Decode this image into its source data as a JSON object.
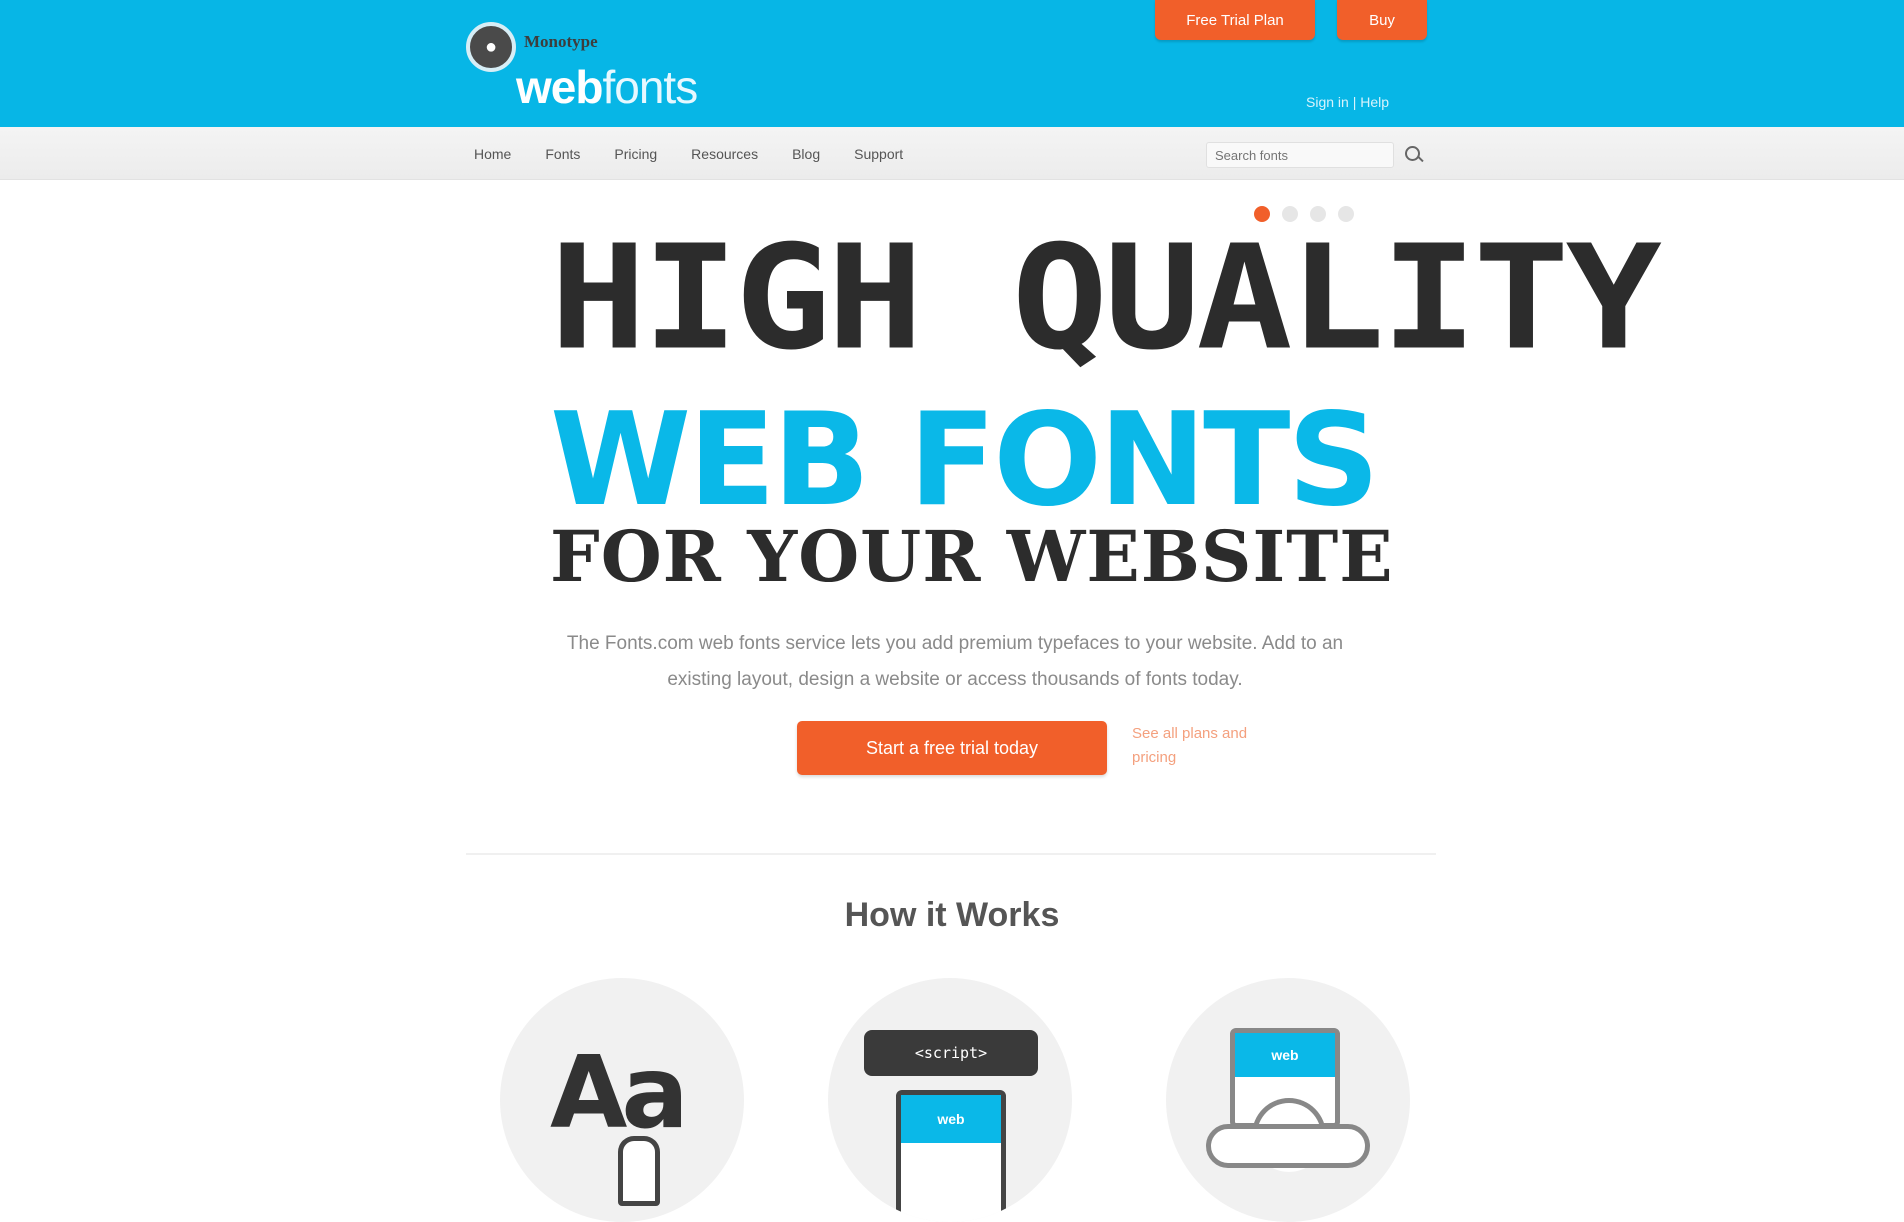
{
  "header": {
    "logo_small": "Monotype",
    "logo_main_bold": "web",
    "logo_main_thin": "fonts",
    "trial_button": "Free Trial Plan",
    "buy_button": "Buy",
    "signin_link": "Sign in | Help"
  },
  "nav": {
    "items": [
      {
        "label": "Home"
      },
      {
        "label": "Fonts"
      },
      {
        "label": "Pricing"
      },
      {
        "label": "Resources"
      },
      {
        "label": "Blog"
      },
      {
        "label": "Support"
      }
    ],
    "search_placeholder": "Search fonts"
  },
  "hero": {
    "slider_dots": 4,
    "active_dot": 1,
    "line1": "HIGH QUALITY",
    "line2": "WEB FONTS",
    "line3": "FOR YOUR WEBSITE",
    "description": "The Fonts.com web fonts service lets you add premium typefaces to your website. Add to an existing layout, design a website or access thousands of fonts today.",
    "cta_button": "Start a free trial today",
    "cta_side": "See all plans and pricing"
  },
  "section": {
    "title": "How it Works"
  },
  "features": [
    {
      "icon": "font-select-icon",
      "glyph": "Aa"
    },
    {
      "icon": "embed-code-icon",
      "code": "<script>",
      "browser_label": "web"
    },
    {
      "icon": "cloud-host-icon",
      "screen_label": "web"
    }
  ],
  "colors": {
    "brand_blue": "#07b6e6",
    "accent_orange": "#f15f2a",
    "dark_text": "#2c2c2c"
  }
}
